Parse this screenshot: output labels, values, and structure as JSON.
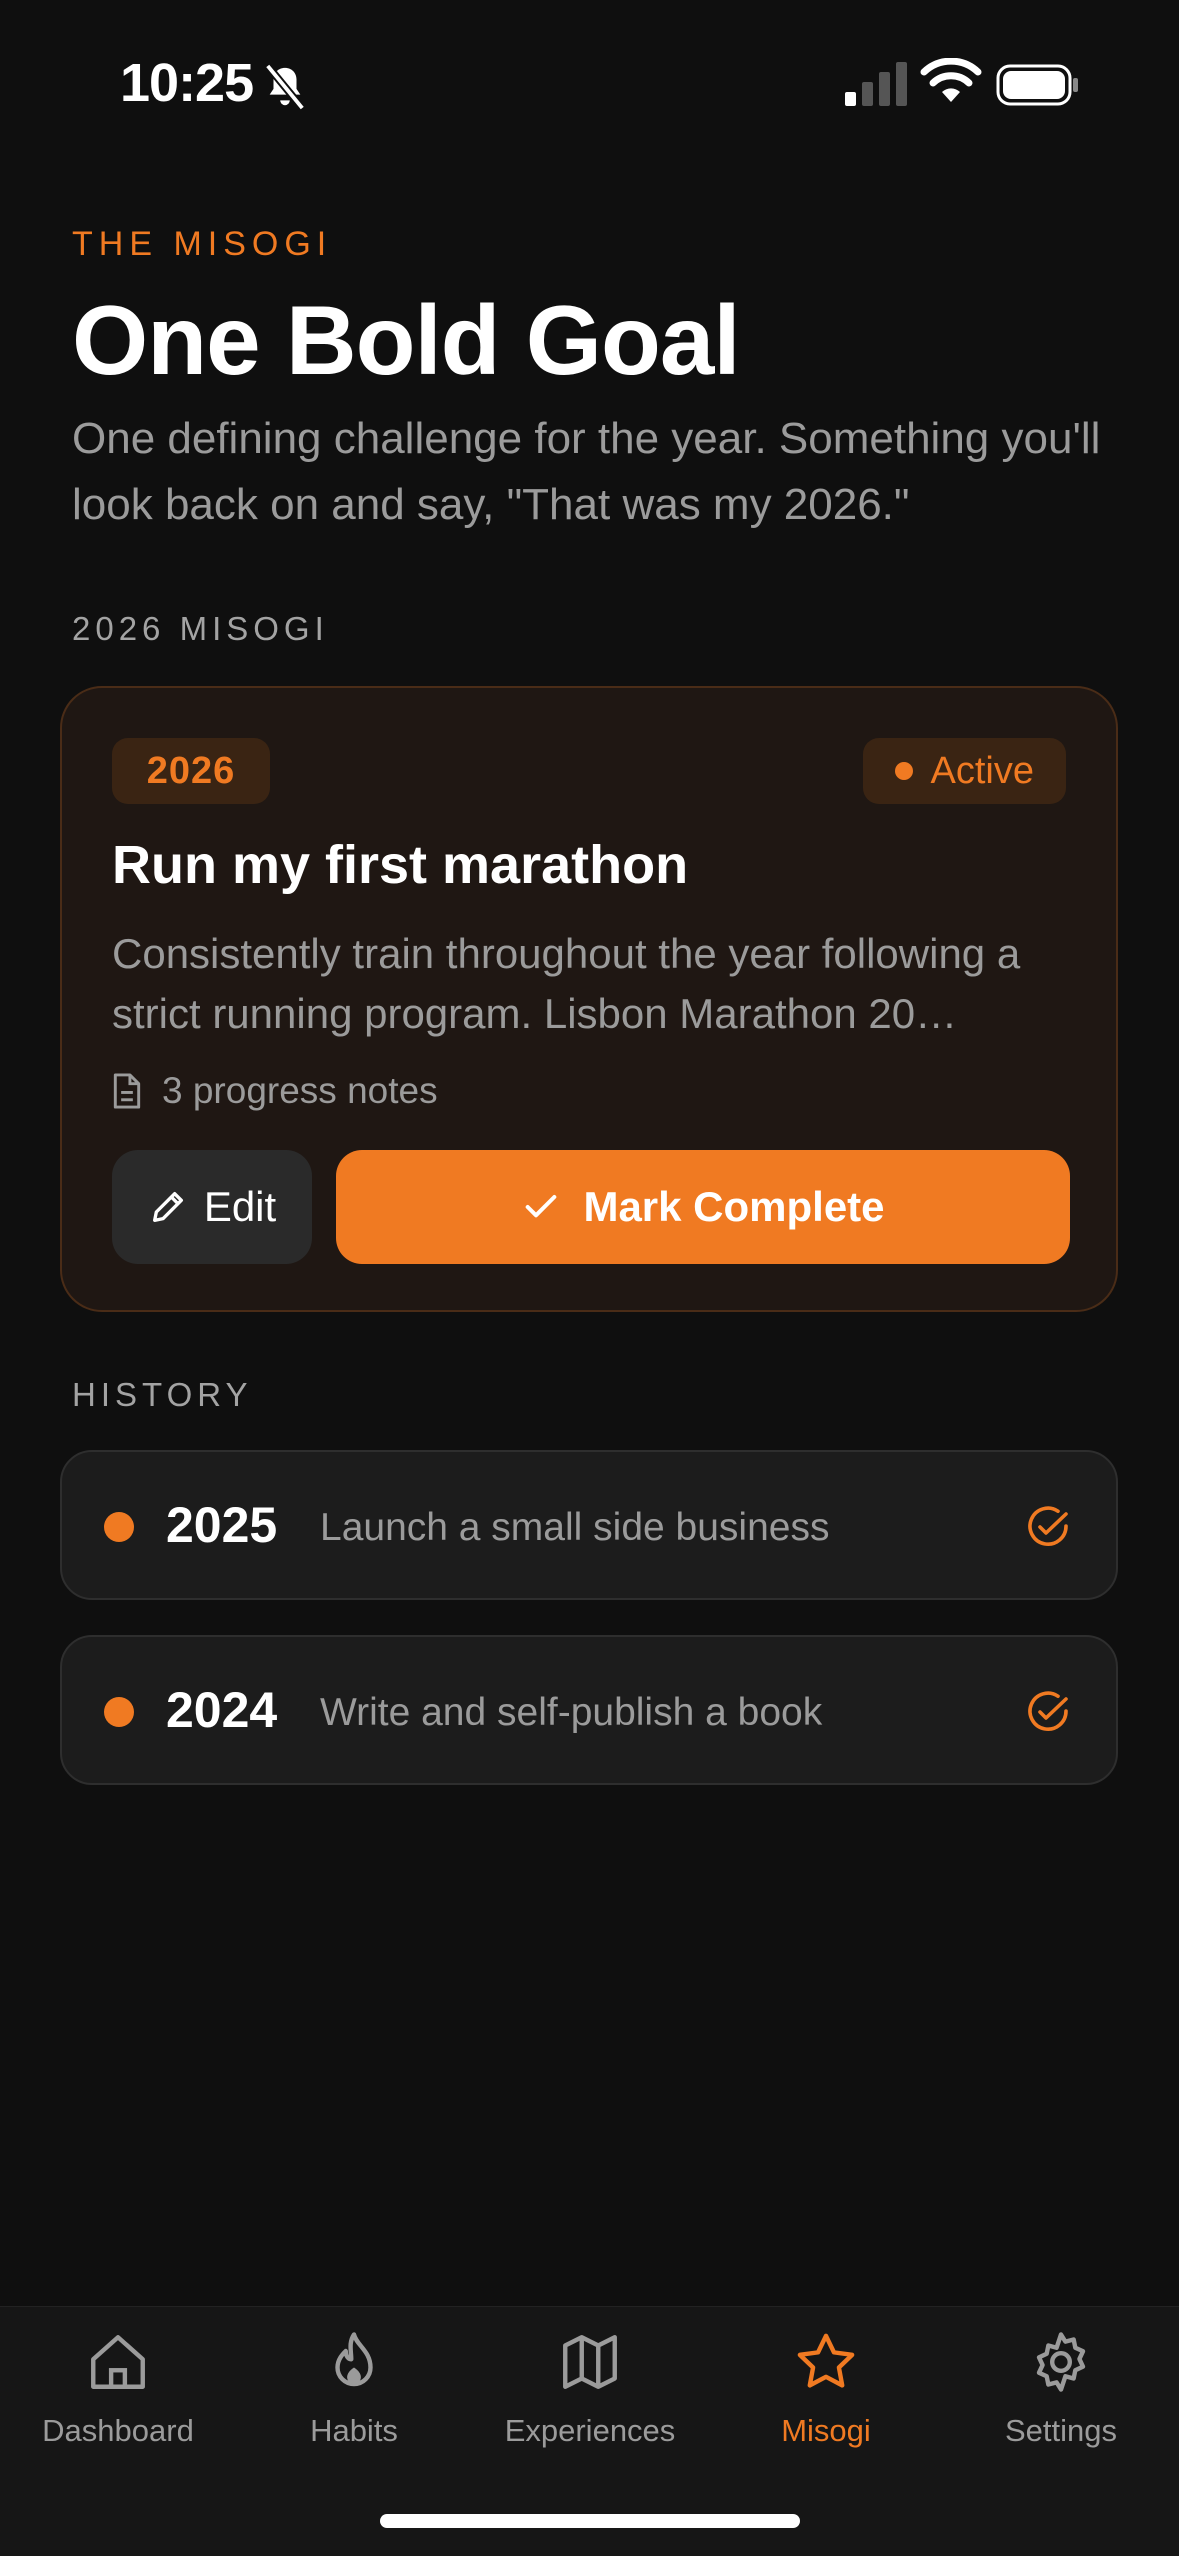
{
  "status_bar": {
    "time": "10:25"
  },
  "header": {
    "eyebrow": "THE MISOGI",
    "title": "One Bold Goal",
    "subtitle": "One defining challenge for the year. Something you'll look back on and say, \"That was my 2026.\""
  },
  "current_section": {
    "label": "2026 MISOGI"
  },
  "current": {
    "year": "2026",
    "status": "Active",
    "title": "Run my first marathon",
    "description": "Consistently train throughout the year following a strict running program. Lisbon Marathon 20…",
    "notes": "3 progress notes",
    "edit_label": "Edit",
    "complete_label": "Mark Complete"
  },
  "history": {
    "label": "HISTORY",
    "items": [
      {
        "year": "2025",
        "text": "Launch a small side business"
      },
      {
        "year": "2024",
        "text": "Write and self-publish a book"
      }
    ]
  },
  "tabs": [
    {
      "label": "Dashboard",
      "icon": "home-icon"
    },
    {
      "label": "Habits",
      "icon": "flame-icon"
    },
    {
      "label": "Experiences",
      "icon": "map-icon"
    },
    {
      "label": "Misogi",
      "icon": "star-icon",
      "active": true
    },
    {
      "label": "Settings",
      "icon": "gear-icon"
    }
  ],
  "colors": {
    "accent": "#f07a22",
    "background": "#0f0f0f",
    "card": "#1f1713"
  }
}
